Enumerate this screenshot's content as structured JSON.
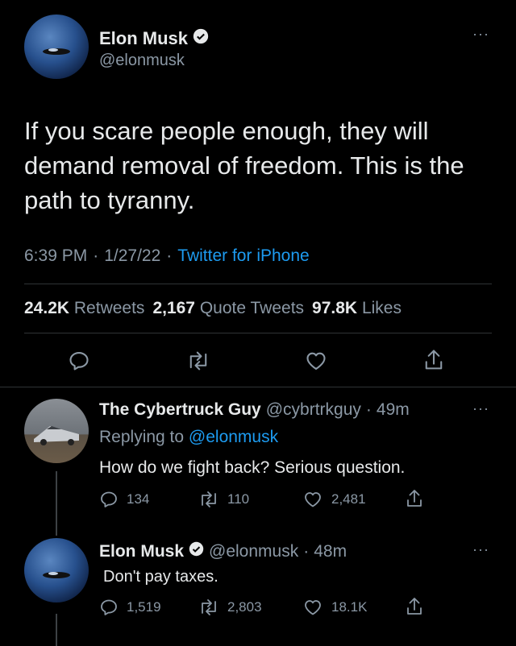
{
  "main_tweet": {
    "author_name": "Elon Musk",
    "author_handle": "@elonmusk",
    "text": "If you scare people enough, they will demand removal of freedom. This is the path to tyranny.",
    "time": "6:39 PM",
    "date": "1/27/22",
    "sep": "·",
    "source": "Twitter for iPhone",
    "stats": {
      "retweets_count": "24.2K",
      "retweets_label": "Retweets",
      "quotes_count": "2,167",
      "quotes_label": "Quote Tweets",
      "likes_count": "97.8K",
      "likes_label": "Likes"
    },
    "more": "···"
  },
  "reply_1": {
    "author_name": "The Cybertruck Guy",
    "author_handle": "@cybrtrkguy",
    "sep": "·",
    "age": "49m",
    "replying_prefix": "Replying to",
    "replying_to": "@elonmusk",
    "text": "How do we fight back? Serious question.",
    "replies": "134",
    "retweets": "110",
    "likes": "2,481",
    "more": "···"
  },
  "reply_2": {
    "author_name": "Elon Musk",
    "author_handle": "@elonmusk",
    "sep": "·",
    "age": "48m",
    "text": "Don't pay taxes.",
    "replies": "1,519",
    "retweets": "2,803",
    "likes": "18.1K",
    "more": "···"
  },
  "colors": {
    "background": "#000000",
    "text": "#e7e9ea",
    "muted": "#8b98a5",
    "accent": "#1d9bf0"
  }
}
